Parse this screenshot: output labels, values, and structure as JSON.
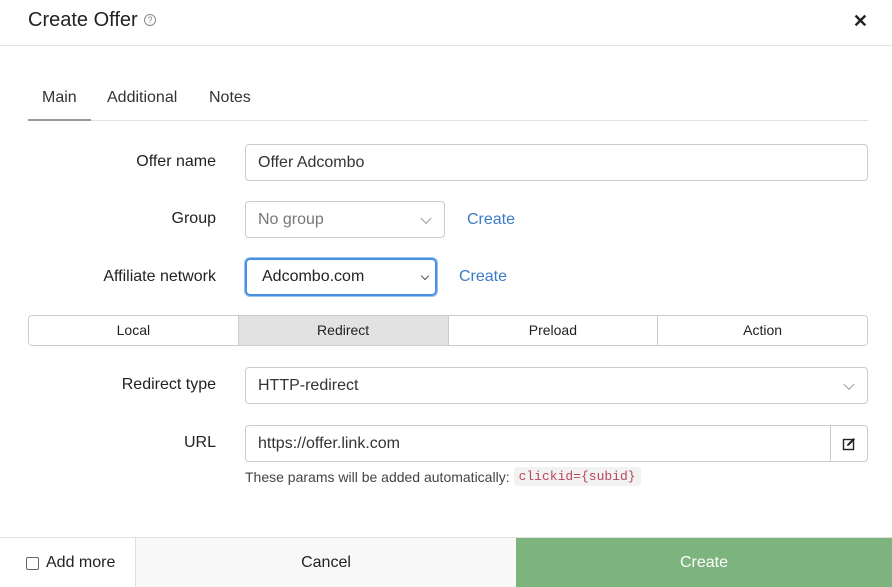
{
  "header": {
    "title": "Create Offer",
    "help_icon": "question-circle-icon",
    "help_glyph": "?",
    "close_glyph": "✕"
  },
  "tabs": [
    {
      "label": "Main",
      "active": true
    },
    {
      "label": "Additional",
      "active": false
    },
    {
      "label": "Notes",
      "active": false
    }
  ],
  "form": {
    "offer_name": {
      "label": "Offer name",
      "value": "Offer Adcombo"
    },
    "group": {
      "label": "Group",
      "value": "No group",
      "create_label": "Create"
    },
    "affiliate_network": {
      "label": "Affiliate network",
      "value": "Adcombo.com",
      "create_label": "Create"
    },
    "modes": [
      {
        "label": "Local",
        "active": false
      },
      {
        "label": "Redirect",
        "active": true
      },
      {
        "label": "Preload",
        "active": false
      },
      {
        "label": "Action",
        "active": false
      }
    ],
    "redirect_type": {
      "label": "Redirect type",
      "value": "HTTP-redirect"
    },
    "url": {
      "label": "URL",
      "value": "https://offer.link.com",
      "edit_icon": "edit-icon"
    },
    "hint": {
      "text": "These params will be added automatically:",
      "code": "clickid={subid}"
    }
  },
  "footer": {
    "add_more_label": "Add more",
    "add_more_checked": false,
    "cancel_label": "Cancel",
    "create_label": "Create"
  },
  "colors": {
    "primary_button": "#7db37d",
    "link": "#3a7cc7",
    "focus": "#4a90e2"
  }
}
